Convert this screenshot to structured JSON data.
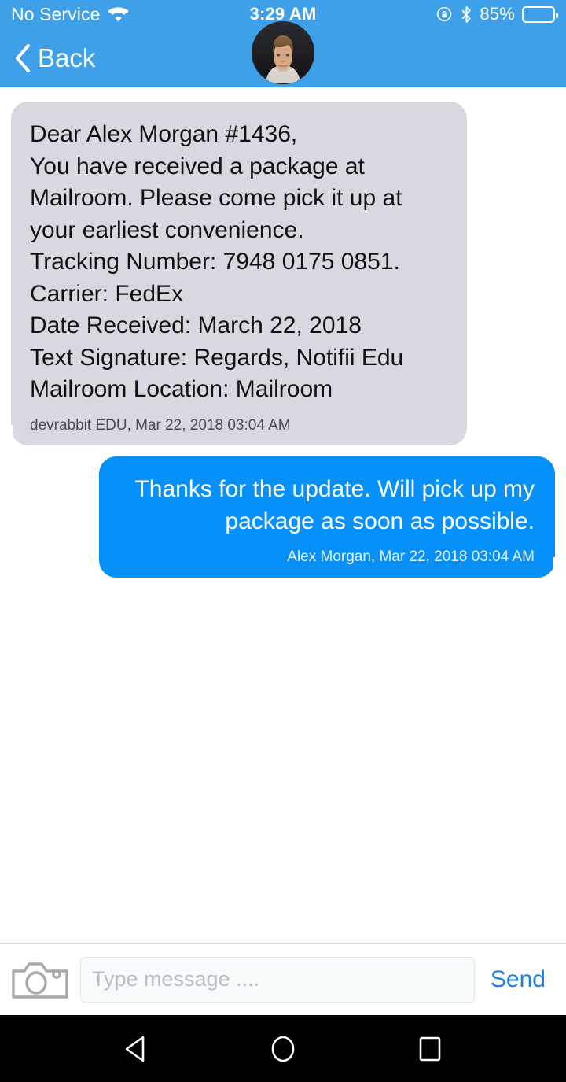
{
  "status_bar": {
    "carrier": "No Service",
    "wifi_icon": "wifi-icon",
    "time": "3:29 AM",
    "rotation_lock_icon": "rotation-lock-icon",
    "bluetooth_icon": "bluetooth-icon",
    "battery_percent": "85%",
    "battery_level": 85,
    "battery_icon": "battery-icon"
  },
  "nav_bar": {
    "back_label": "Back",
    "back_icon": "chevron-left-icon",
    "avatar_alt": "contact-avatar",
    "background_color": "#3FA0EA"
  },
  "conversation": {
    "messages": [
      {
        "direction": "incoming",
        "body": "Dear  Alex Morgan #1436,\n You have received a package at Mailroom. Please come pick it up at your earliest convenience.\nTracking Number: 7948 0175 0851.\nCarrier: FedEx\nDate Received: March 22, 2018\nText Signature: Regards, Notifii Edu\nMailroom Location: Mailroom",
        "sender": "devrabbit EDU",
        "timestamp": "Mar 22, 2018 03:04 AM",
        "meta": "devrabbit EDU, Mar 22, 2018 03:04 AM",
        "bubble_color": "#D8D9E0",
        "text_color": "#111114"
      },
      {
        "direction": "outgoing",
        "body": "Thanks for the update. Will pick up my package as soon as possible.",
        "sender": "Alex Morgan",
        "timestamp": "Mar 22, 2018 03:04 AM",
        "meta": "Alex Morgan, Mar 22, 2018 03:04 AM",
        "bubble_color": "#0690FA",
        "text_color": "#FFFFFF"
      }
    ]
  },
  "composer": {
    "camera_icon": "camera-icon",
    "input_value": "",
    "input_placeholder": "Type message ....",
    "send_label": "Send",
    "send_color": "#1A7EE8"
  },
  "system_nav": {
    "back_icon": "android-back-triangle-icon",
    "home_icon": "android-home-circle-icon",
    "recents_icon": "android-recents-square-icon"
  }
}
